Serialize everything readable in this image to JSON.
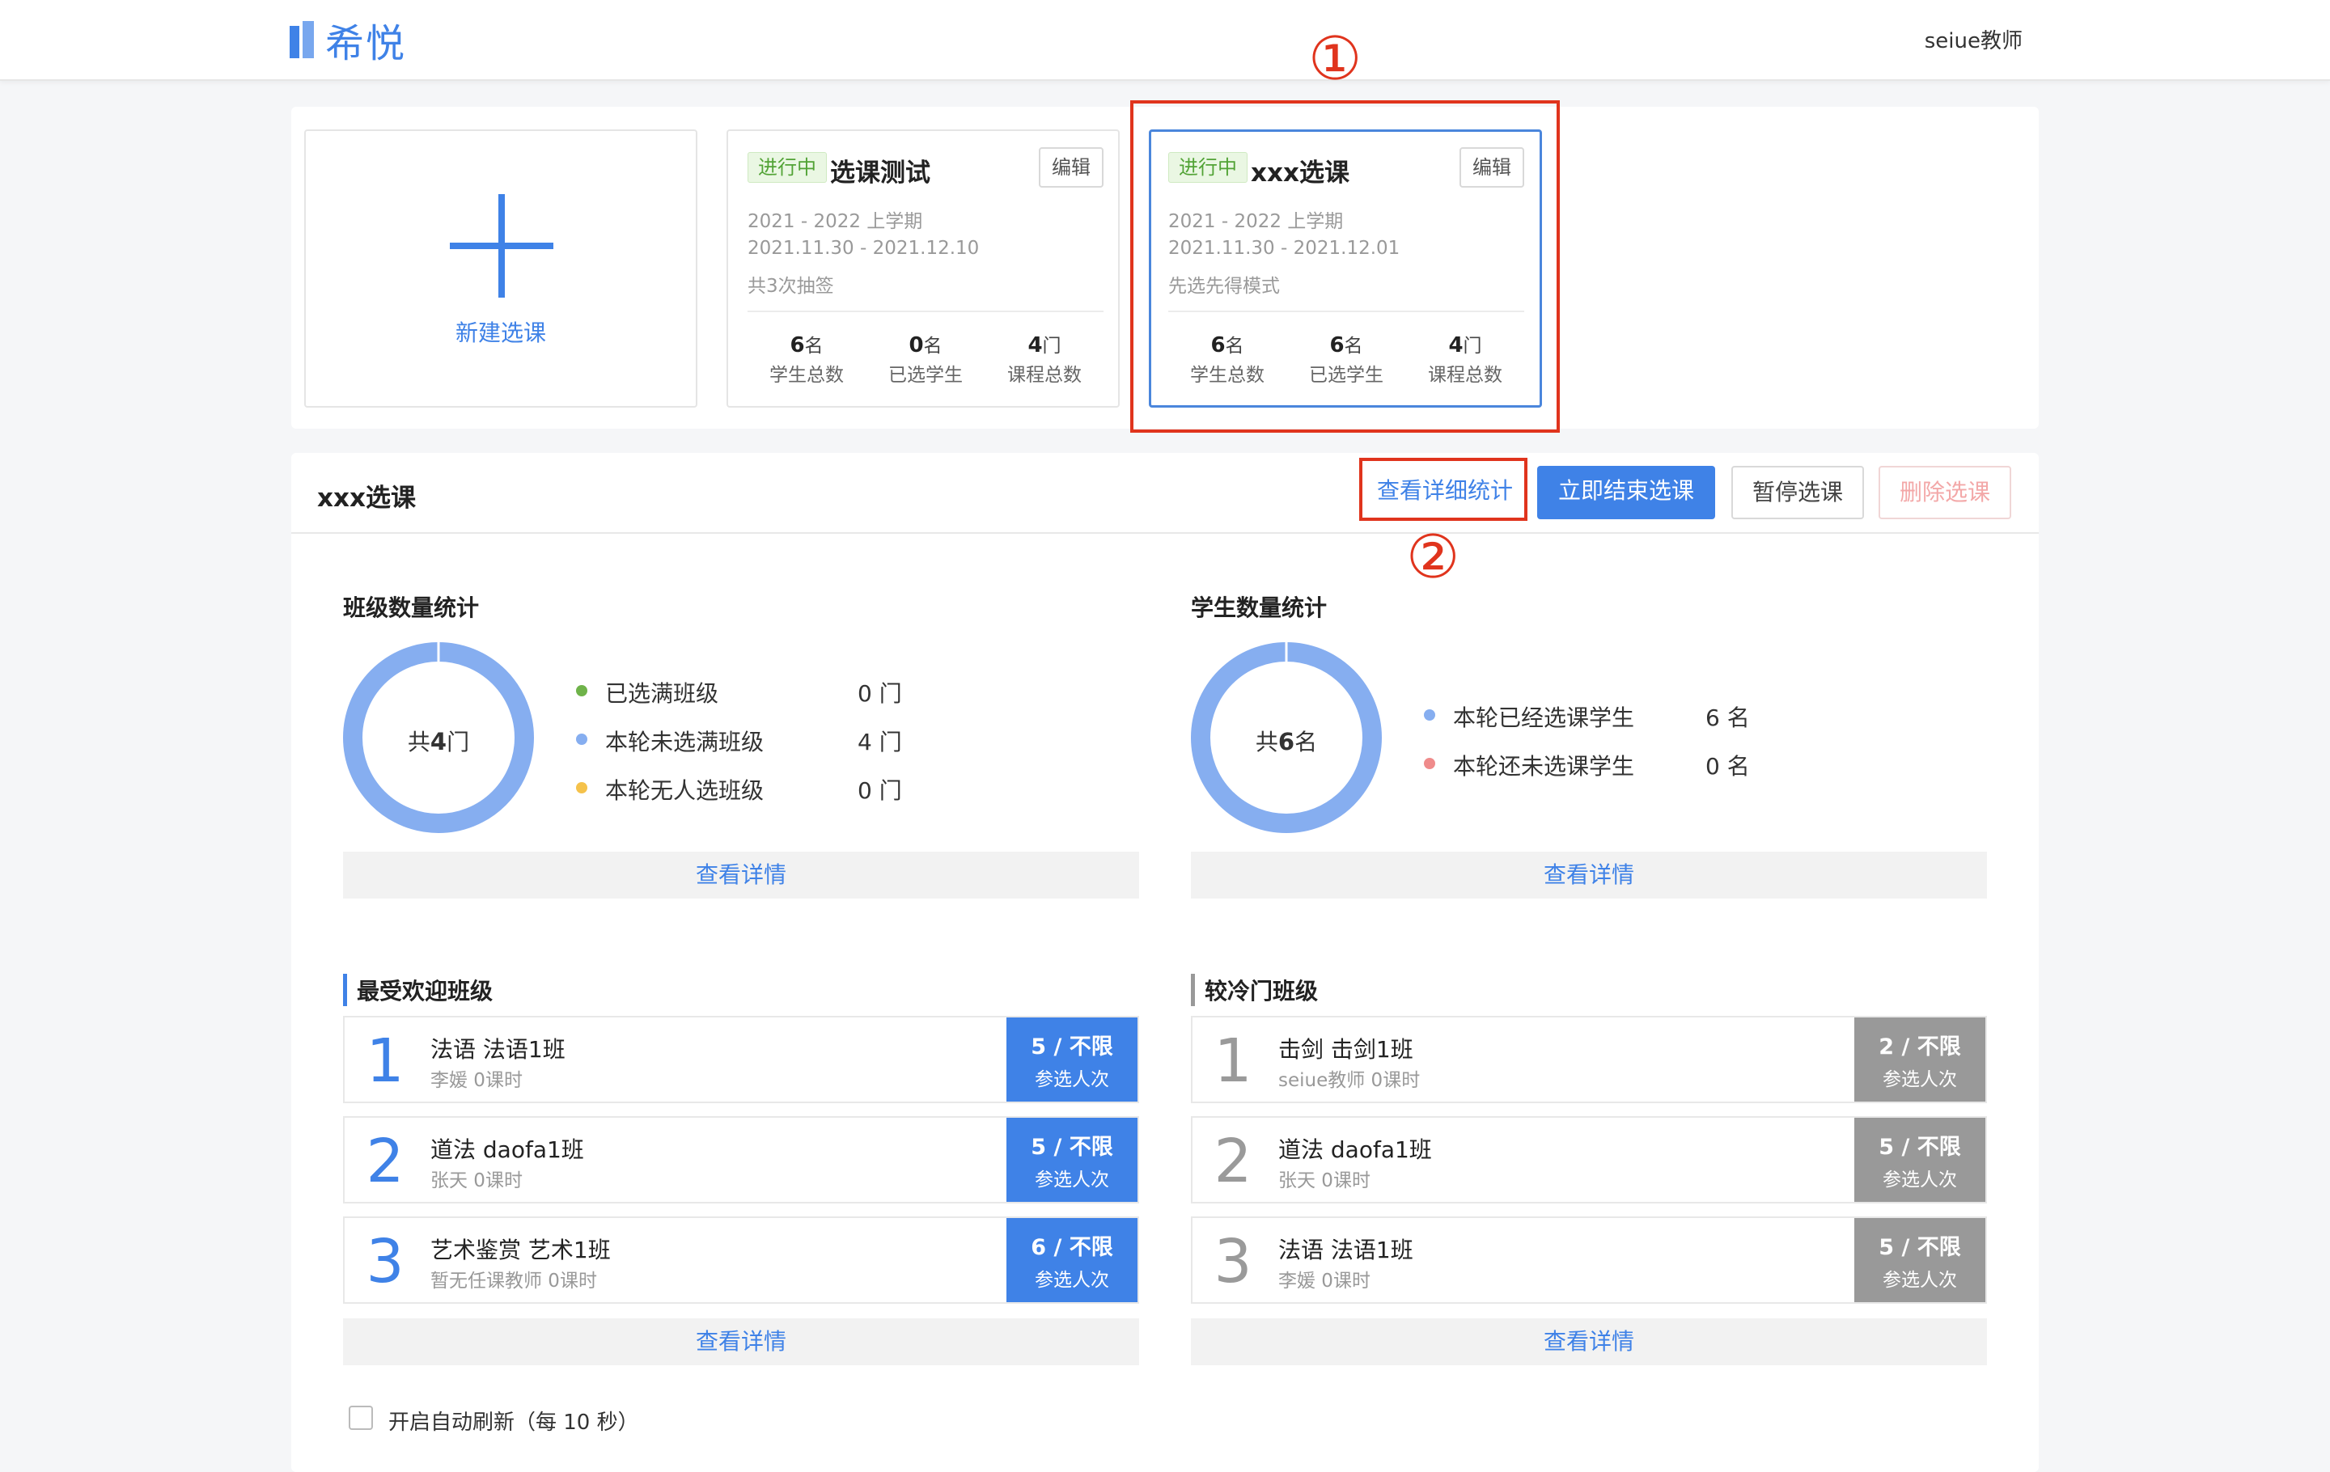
{
  "header": {
    "logo_text": "希悦",
    "user_name": "seiue教师"
  },
  "cards": {
    "new_label": "新建选课",
    "items": [
      {
        "status": "进行中",
        "title": "选课测试",
        "edit_label": "编辑",
        "term": "2021 - 2022 上学期",
        "dates": "2021.11.30 - 2021.12.10",
        "mode": "共3次抽签",
        "stats": [
          {
            "num": "6",
            "unit": "名",
            "label": "学生总数"
          },
          {
            "num": "0",
            "unit": "名",
            "label": "已选学生"
          },
          {
            "num": "4",
            "unit": "门",
            "label": "课程总数"
          }
        ]
      },
      {
        "status": "进行中",
        "title": "xxx选课",
        "edit_label": "编辑",
        "term": "2021 - 2022 上学期",
        "dates": "2021.11.30 - 2021.12.01",
        "mode": "先选先得模式",
        "stats": [
          {
            "num": "6",
            "unit": "名",
            "label": "学生总数"
          },
          {
            "num": "6",
            "unit": "名",
            "label": "已选学生"
          },
          {
            "num": "4",
            "unit": "门",
            "label": "课程总数"
          }
        ]
      }
    ]
  },
  "annotations": {
    "one": "①",
    "two": "②"
  },
  "main": {
    "title": "xxx选课",
    "buttons": {
      "detail_stats": "查看详细统计",
      "end": "立即结束选课",
      "pause": "暂停选课",
      "delete": "删除选课"
    },
    "class_stats": {
      "title": "班级数量统计",
      "center_prefix": "共",
      "center_num": "4",
      "center_unit": "门",
      "legend": [
        {
          "label": "已选满班级",
          "value": "0 门",
          "color": "#6fb34a"
        },
        {
          "label": "本轮未选满班级",
          "value": "4 门",
          "color": "#86aef0"
        },
        {
          "label": "本轮无人选班级",
          "value": "0 门",
          "color": "#f5c24b"
        }
      ],
      "details": "查看详情"
    },
    "student_stats": {
      "title": "学生数量统计",
      "center_prefix": "共",
      "center_num": "6",
      "center_unit": "名",
      "legend": [
        {
          "label": "本轮已经选课学生",
          "value": "6 名",
          "color": "#86aef0"
        },
        {
          "label": "本轮还未选课学生",
          "value": "0 名",
          "color": "#ef8b8b"
        }
      ],
      "details": "查看详情"
    },
    "popular": {
      "title": "最受欢迎班级",
      "rows": [
        {
          "rank": "1",
          "name": "法语 法语1班",
          "sub": "李媛 0课时",
          "count": "5 / 不限",
          "count_label": "参选人次"
        },
        {
          "rank": "2",
          "name": "道法 daofa1班",
          "sub": "张天 0课时",
          "count": "5 / 不限",
          "count_label": "参选人次"
        },
        {
          "rank": "3",
          "name": "艺术鉴赏 艺术1班",
          "sub": "暂无任课教师 0课时",
          "count": "6 / 不限",
          "count_label": "参选人次"
        }
      ],
      "details": "查看详情"
    },
    "unpopular": {
      "title": "较冷门班级",
      "rows": [
        {
          "rank": "1",
          "name": "击剑 击剑1班",
          "sub": "seiue教师 0课时",
          "count": "2 / 不限",
          "count_label": "参选人次"
        },
        {
          "rank": "2",
          "name": "道法 daofa1班",
          "sub": "张天 0课时",
          "count": "5 / 不限",
          "count_label": "参选人次"
        },
        {
          "rank": "3",
          "name": "法语 法语1班",
          "sub": "李媛 0课时",
          "count": "5 / 不限",
          "count_label": "参选人次"
        }
      ],
      "details": "查看详情"
    },
    "auto_refresh_label": "开启自动刷新（每 10 秒）"
  },
  "colors": {
    "primary": "#3f82e7",
    "donut": "#86aef0",
    "annotation": "#e0341d"
  }
}
